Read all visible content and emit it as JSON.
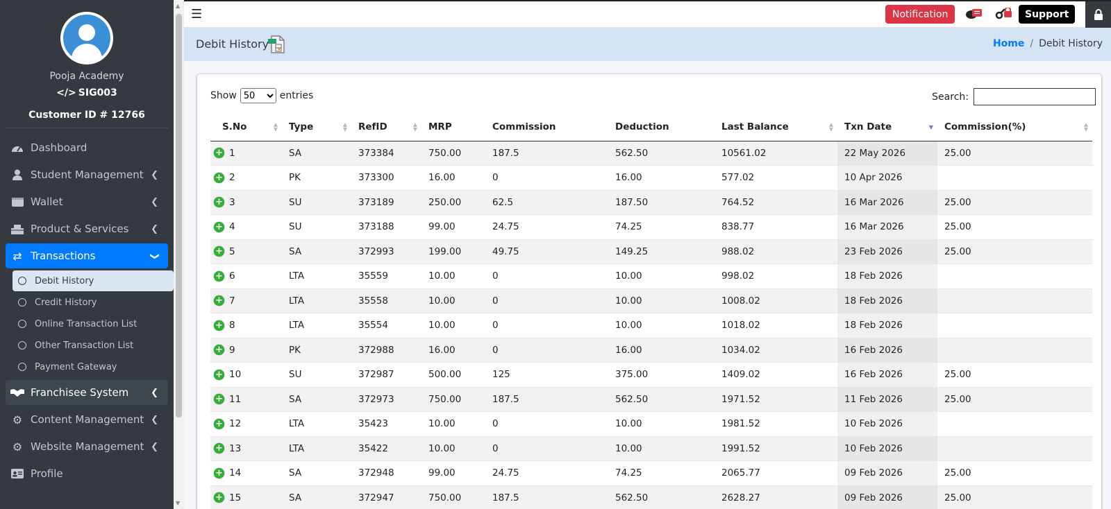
{
  "sidebar": {
    "academy_name": "Pooja Academy",
    "sig_code": "SIG003",
    "customer_id": "Customer ID # 12766",
    "items": [
      {
        "label": "Dashboard",
        "icon": "dashboard-icon"
      },
      {
        "label": "Student Management",
        "icon": "user-icon"
      },
      {
        "label": "Wallet",
        "icon": "wallet-icon"
      },
      {
        "label": "Product & Services",
        "icon": "product-icon"
      },
      {
        "label": "Transactions",
        "icon": "exchange-icon"
      },
      {
        "label": "Franchisee System",
        "icon": "handshake-icon"
      },
      {
        "label": "Content Management",
        "icon": "gear-icon"
      },
      {
        "label": "Website Management",
        "icon": "gear-icon"
      },
      {
        "label": "Profile",
        "icon": "id-card-icon"
      }
    ],
    "sub_items": [
      {
        "label": "Debit History"
      },
      {
        "label": "Credit History"
      },
      {
        "label": "Online Transaction List"
      },
      {
        "label": "Other Transaction List"
      },
      {
        "label": "Payment Gateway"
      }
    ]
  },
  "topbar": {
    "notification_label": "Notification",
    "support_label": "Support"
  },
  "header": {
    "title": "Debit History",
    "breadcrumb_home": "Home",
    "breadcrumb_sep": "/",
    "breadcrumb_current": "Debit History"
  },
  "table_controls": {
    "show_label": "Show",
    "entries_value": "50",
    "entries_label": "entries",
    "search_label": "Search:",
    "search_value": ""
  },
  "table": {
    "columns": [
      "S.No",
      "Type",
      "RefID",
      "MRP",
      "Commission",
      "Deduction",
      "Last Balance",
      "Txn Date",
      "Commission(%)"
    ],
    "rows": [
      [
        "1",
        "SA",
        "373384",
        "750.00",
        "187.5",
        "562.50",
        "10561.02",
        "22 May 2026",
        "25.00"
      ],
      [
        "2",
        "PK",
        "373300",
        "16.00",
        "0",
        "16.00",
        "577.02",
        "10 Apr 2026",
        ""
      ],
      [
        "3",
        "SU",
        "373189",
        "250.00",
        "62.5",
        "187.50",
        "764.52",
        "16 Mar 2026",
        "25.00"
      ],
      [
        "4",
        "SU",
        "373188",
        "99.00",
        "24.75",
        "74.25",
        "838.77",
        "16 Mar 2026",
        "25.00"
      ],
      [
        "5",
        "SA",
        "372993",
        "199.00",
        "49.75",
        "149.25",
        "988.02",
        "23 Feb 2026",
        "25.00"
      ],
      [
        "6",
        "LTA",
        "35559",
        "10.00",
        "0",
        "10.00",
        "998.02",
        "18 Feb 2026",
        ""
      ],
      [
        "7",
        "LTA",
        "35558",
        "10.00",
        "0",
        "10.00",
        "1008.02",
        "18 Feb 2026",
        ""
      ],
      [
        "8",
        "LTA",
        "35554",
        "10.00",
        "0",
        "10.00",
        "1018.02",
        "18 Feb 2026",
        ""
      ],
      [
        "9",
        "PK",
        "372988",
        "16.00",
        "0",
        "16.00",
        "1034.02",
        "16 Feb 2026",
        ""
      ],
      [
        "10",
        "SU",
        "372987",
        "500.00",
        "125",
        "375.00",
        "1409.02",
        "16 Feb 2026",
        "25.00"
      ],
      [
        "11",
        "SA",
        "372973",
        "750.00",
        "187.5",
        "562.50",
        "1971.52",
        "11 Feb 2026",
        "25.00"
      ],
      [
        "12",
        "LTA",
        "35423",
        "10.00",
        "0",
        "10.00",
        "1981.52",
        "10 Feb 2026",
        ""
      ],
      [
        "13",
        "LTA",
        "35422",
        "10.00",
        "0",
        "10.00",
        "1991.52",
        "10 Feb 2026",
        ""
      ],
      [
        "14",
        "SA",
        "372948",
        "99.00",
        "24.75",
        "74.25",
        "2065.77",
        "09 Feb 2026",
        "25.00"
      ],
      [
        "15",
        "SA",
        "372947",
        "750.00",
        "187.5",
        "562.50",
        "2628.27",
        "09 Feb 2026",
        "25.00"
      ]
    ]
  },
  "colors": {
    "sidebar_bg": "#343a40",
    "active_blue": "#007bff",
    "notification_red": "#dc3545",
    "header_bg": "#d4e4f4",
    "plus_green": "#31b131"
  }
}
